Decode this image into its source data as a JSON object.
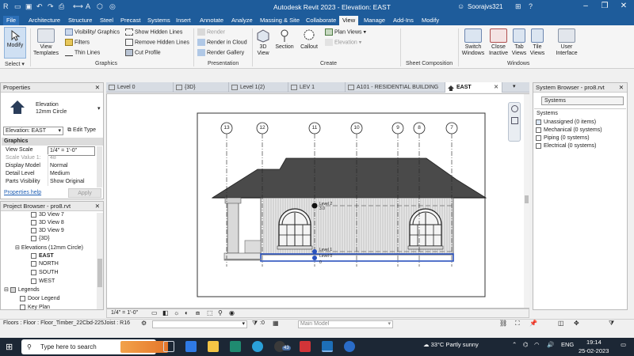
{
  "window": {
    "title": "Autodesk Revit 2023 - Elevation: EAST",
    "user": "Soorajvs321",
    "colors": {
      "titlebar": "#1e5c9b",
      "taskbar": "#1c2735",
      "selection": "#2a52be"
    }
  },
  "menu": {
    "tabs": [
      "File",
      "Architecture",
      "Structure",
      "Steel",
      "Precast",
      "Systems",
      "Insert",
      "Annotate",
      "Analyze",
      "Massing & Site",
      "Collaborate",
      "View",
      "Manage",
      "Add-Ins",
      "Modify"
    ],
    "active": "View"
  },
  "ribbon": {
    "modify": "Modify",
    "select_panel": "Select ▾",
    "view_templates": "View Templates",
    "visibility_graphics": "Visibility/ Graphics",
    "filters": "Filters",
    "thin_lines": "Thin Lines",
    "show_hidden_lines": "Show Hidden Lines",
    "remove_hidden_lines": "Remove Hidden Lines",
    "cut_profile": "Cut Profile",
    "graphics_panel": "Graphics",
    "render": "Render",
    "render_cloud": "Render in Cloud",
    "render_gallery": "Render Gallery",
    "presentation_panel": "Presentation",
    "view_3d": "3D View",
    "section": "Section",
    "callout": "Callout",
    "plan_views": "Plan Views",
    "elevation": "Elevation",
    "create_panel": "Create",
    "sheet_panel": "Sheet Composition",
    "switch_windows": "Switch Windows",
    "close_inactive": "Close Inactive",
    "tab_views": "Tab Views",
    "tile_views": "Tile Views",
    "user_interface": "User Interface",
    "windows_panel": "Windows"
  },
  "view_tabs": [
    {
      "label": "Level 0",
      "active": false
    },
    {
      "label": "{3D}",
      "active": false
    },
    {
      "label": "Level 1(2)",
      "active": false
    },
    {
      "label": "LEV 1",
      "active": false
    },
    {
      "label": "A101 - RESIDENTIAL BUILDING",
      "active": false
    },
    {
      "label": "EAST",
      "active": true
    }
  ],
  "properties": {
    "title": "Properties",
    "family": "Elevation",
    "type": "12mm Circle",
    "selector": "Elevation: EAST",
    "edit_type": "Edit Type",
    "section": "Graphics",
    "rows": [
      {
        "k": "View Scale",
        "v": "1/4\" = 1'-0\""
      },
      {
        "k": "Scale Value 1:",
        "v": "48"
      },
      {
        "k": "Display Model",
        "v": "Normal"
      },
      {
        "k": "Detail Level",
        "v": "Medium"
      },
      {
        "k": "Parts Visibility",
        "v": "Show Original"
      }
    ],
    "help": "Properties help",
    "apply": "Apply"
  },
  "project_browser": {
    "title": "Project Browser - pro8.rvt",
    "items": [
      "3D View 7",
      "3D View 8",
      "3D View 9",
      "{3D}",
      "Elevations (12mm Circle)",
      "EAST",
      "NORTH",
      "SOUTH",
      "WEST",
      "Legends",
      "Door Legend",
      "Key Plan"
    ]
  },
  "system_browser": {
    "title": "System Browser - pro8.rvt",
    "dropdown": "Systems",
    "header": "Systems",
    "items": [
      "Unassigned (0 items)",
      "Mechanical (0 systems)",
      "Piping (0 systems)",
      "Electrical (0 systems)"
    ]
  },
  "drawing": {
    "grid_labels": [
      "13",
      "12",
      "11",
      "10",
      "9",
      "8",
      "7"
    ],
    "level_labels": [
      "Level 2",
      "Level 1",
      "Level 0"
    ],
    "level_values": [
      "3.0",
      "0.0",
      "0"
    ]
  },
  "view_control": {
    "scale": "1/4\" = 1'-0\""
  },
  "status": {
    "text": "Floors : Floor : Floor_Timber_22Cbd-225Joist : R16",
    "zero": ":0",
    "model": "Main Model"
  },
  "taskbar": {
    "search": "Type here to search",
    "badge": "43",
    "weather": "33°C  Partly sunny",
    "lang": "ENG",
    "time": "19:14",
    "date": "25-02-2023"
  }
}
